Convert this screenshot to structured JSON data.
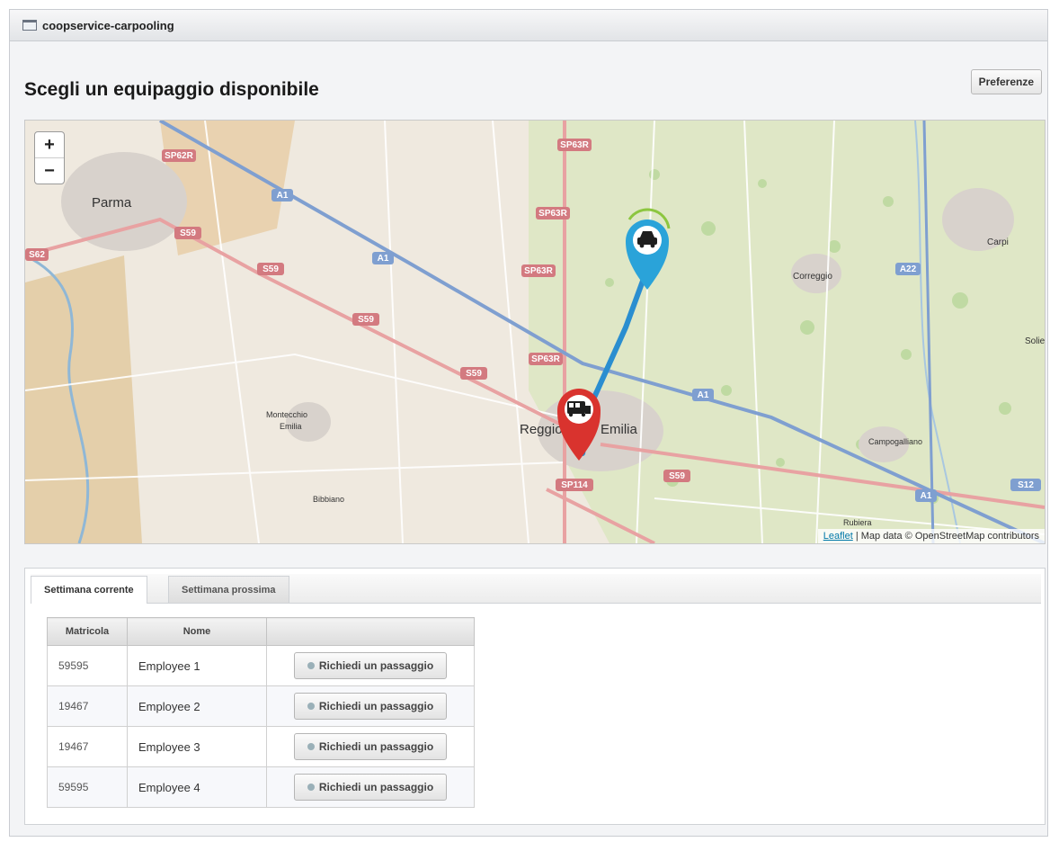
{
  "window": {
    "title": "coopservice-carpooling"
  },
  "header": {
    "title": "Scegli un equipaggio disponibile",
    "preferences_label": "Preferenze"
  },
  "map": {
    "zoom_in": "+",
    "zoom_out": "−",
    "cities": [
      "Parma",
      "Reggio",
      "Emilia",
      "Correggio",
      "Carpi",
      "Soliera",
      "Montecchio",
      "Emilia",
      "Bibbiano",
      "Campogalliano",
      "Rubiera"
    ],
    "road_labels": [
      "SP62R",
      "SP63R",
      "SP63R",
      "SP63R",
      "SP63R",
      "A1",
      "A1",
      "A1",
      "A1",
      "A22",
      "S59",
      "S59",
      "S59",
      "S59",
      "S59",
      "SP114",
      "S62",
      "S12"
    ],
    "markers": [
      {
        "name": "start-marker",
        "color": "#2aa3d9",
        "icon": "car-icon"
      },
      {
        "name": "destination-marker",
        "color": "#d9332e",
        "icon": "bus-icon"
      }
    ],
    "attribution_link": "Leaflet",
    "attribution_text": " | Map data © OpenStreetMap contributors"
  },
  "tabs": [
    {
      "label": "Settimana corrente",
      "active": true
    },
    {
      "label": "Settimana prossima",
      "active": false
    }
  ],
  "table": {
    "columns": [
      "Matricola",
      "Nome",
      ""
    ],
    "rows": [
      {
        "matricola": "59595",
        "nome": "Employee 1",
        "action": "Richiedi un passaggio"
      },
      {
        "matricola": "19467",
        "nome": "Employee 2",
        "action": "Richiedi un passaggio"
      },
      {
        "matricola": "19467",
        "nome": "Employee 3",
        "action": "Richiedi un passaggio"
      },
      {
        "matricola": "59595",
        "nome": "Employee 4",
        "action": "Richiedi un passaggio"
      }
    ]
  },
  "colors": {
    "route": "#2a8ed0",
    "road": "#e8a2a2",
    "label_bg": "#d37a80"
  }
}
